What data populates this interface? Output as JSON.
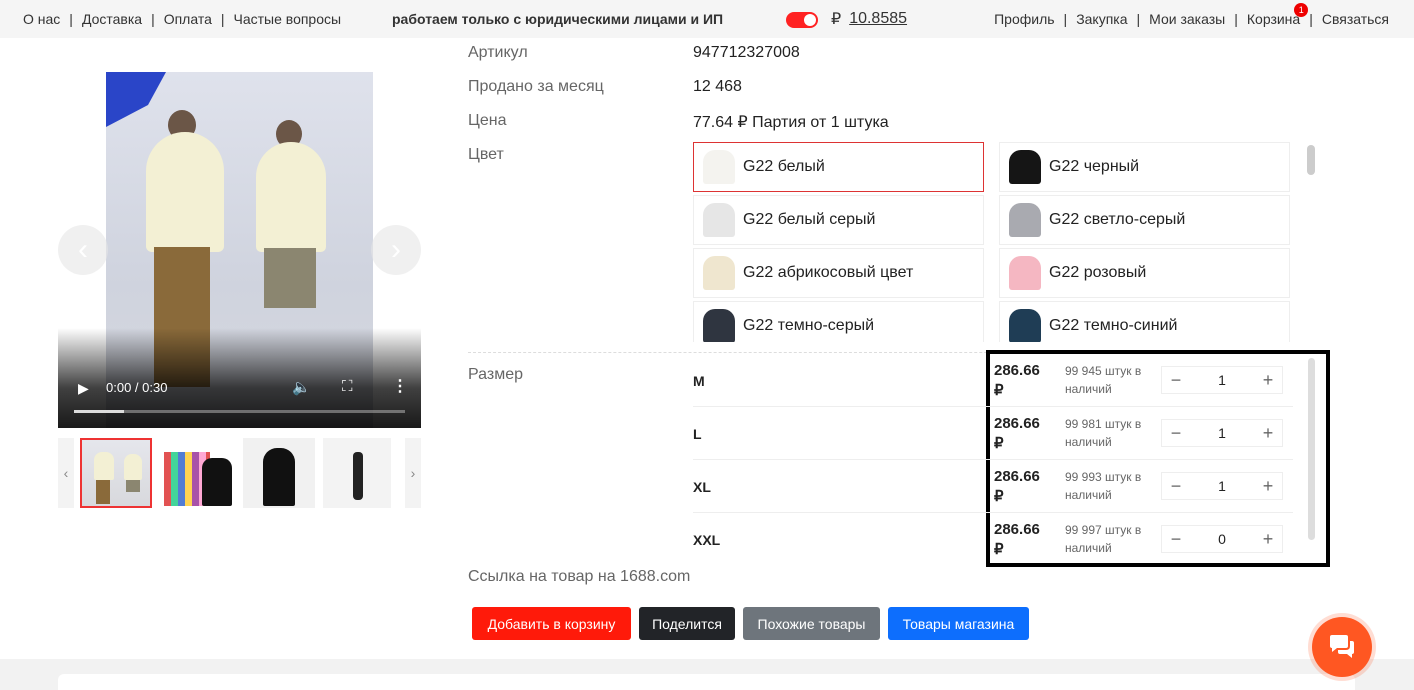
{
  "topbar": {
    "left_links": [
      "О нас",
      "Доставка",
      "Оплата",
      "Частые вопросы"
    ],
    "notice": "работаем только с юридическими лицами и ИП",
    "currency_symbol": "₽",
    "rate": "10.8585",
    "right_links": [
      "Профиль",
      "Закупка",
      "Мои заказы",
      "Корзина",
      "Связаться"
    ],
    "cart_badge": "1",
    "colors": {
      "toggle": "#ff2222"
    }
  },
  "video": {
    "time": "0:00 / 0:30",
    "progress": 0.15
  },
  "product": {
    "sku_label": "Артикул",
    "sku_value": "947712327008",
    "sold_label": "Продано за месяц",
    "sold_value": "12 468",
    "price_label": "Цена",
    "price_value": "77.64 ₽ Партия от 1 штука",
    "color_label": "Цвет",
    "colors": [
      {
        "name": "G22 белый",
        "swatch": "#f4f3ef",
        "selected": true
      },
      {
        "name": "G22 черный",
        "swatch": "#151515",
        "selected": false
      },
      {
        "name": "G22 белый серый",
        "swatch": "#e6e6e6",
        "selected": false
      },
      {
        "name": "G22 светло-серый",
        "swatch": "#a9aab0",
        "selected": false
      },
      {
        "name": "G22 абрикосовый цвет",
        "swatch": "#efe6cf",
        "selected": false
      },
      {
        "name": "G22 розовый",
        "swatch": "#f5b7c2",
        "selected": false
      },
      {
        "name": "G22 темно-серый",
        "swatch": "#2f3540",
        "selected": false
      },
      {
        "name": "G22 темно-синий",
        "swatch": "#1f3d55",
        "selected": false
      }
    ],
    "size_label": "Размер",
    "sizes": [
      {
        "name": "M",
        "price": "286.66",
        "currency": "₽",
        "stock": "99 945 штук в",
        "stock2": "наличий",
        "qty": "1"
      },
      {
        "name": "L",
        "price": "286.66",
        "currency": "₽",
        "stock": "99 981 штук в",
        "stock2": "наличий",
        "qty": "1"
      },
      {
        "name": "XL",
        "price": "286.66",
        "currency": "₽",
        "stock": "99 993 штук в",
        "stock2": "наличий",
        "qty": "1"
      },
      {
        "name": "XXL",
        "price": "286.66",
        "currency": "₽",
        "stock": "99 997 штук в",
        "stock2": "наличий",
        "qty": "0"
      }
    ],
    "link_text": "Ссылка на товар на 1688.com"
  },
  "buttons": {
    "add_to_cart": "Добавить в корзину",
    "share": "Поделится",
    "similar": "Похожие товары",
    "shop": "Товары магазина",
    "colors": {
      "add": "#ff1a0a",
      "share": "#222428",
      "similar": "#6e757c",
      "shop": "#0d6efd"
    }
  }
}
